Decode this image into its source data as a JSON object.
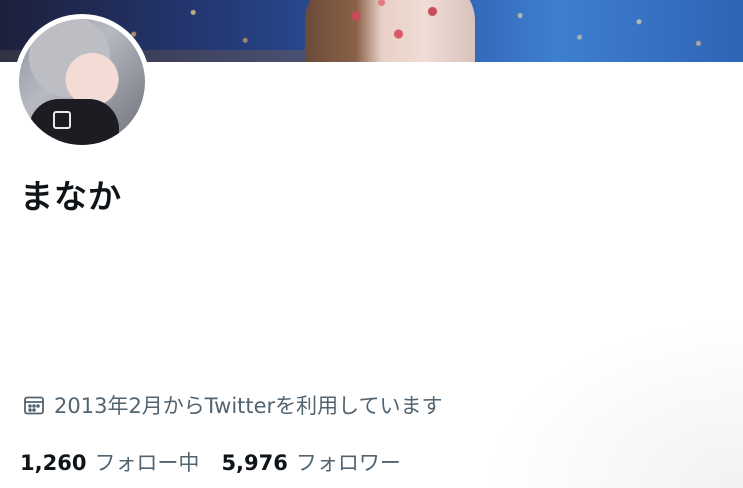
{
  "profile": {
    "display_name": "まなか",
    "join_date_text": "2013年2月からTwitterを利用しています",
    "join_icon": "calendar-icon",
    "following": {
      "count": "1,260",
      "label": "フォロー中"
    },
    "followers": {
      "count": "5,976",
      "label": "フォロワー"
    }
  },
  "colors": {
    "text_primary": "#0f1419",
    "text_secondary": "#536471",
    "background": "#ffffff"
  }
}
